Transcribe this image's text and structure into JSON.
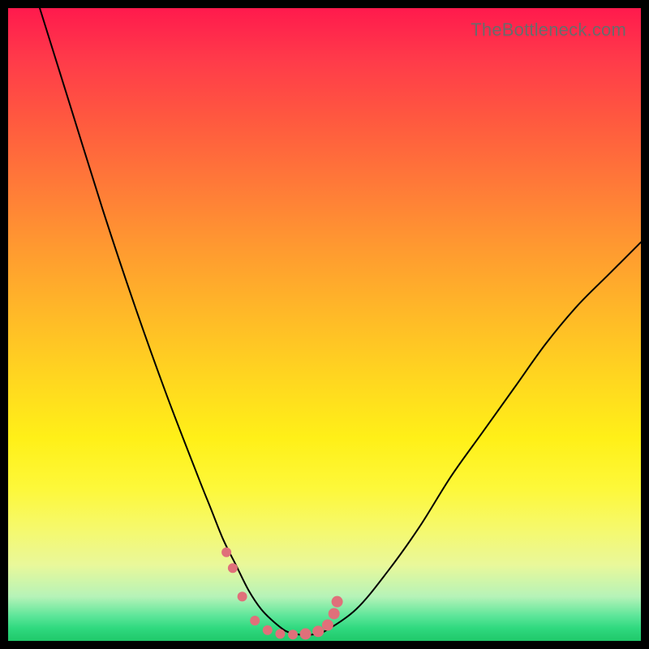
{
  "watermark": {
    "text": "TheBottleneck.com"
  },
  "chart_data": {
    "type": "line",
    "title": "",
    "xlabel": "",
    "ylabel": "",
    "xlim": [
      0,
      100
    ],
    "ylim": [
      0,
      100
    ],
    "grid": false,
    "legend": false,
    "background_gradient": {
      "top": "#ff1a4d",
      "middle": "#fff018",
      "bottom": "#20c86a"
    },
    "series": [
      {
        "name": "bottleneck-curve",
        "color": "#000000",
        "stroke_width": 2,
        "x": [
          5,
          10,
          15,
          20,
          25,
          30,
          32,
          34,
          36,
          38,
          40,
          42,
          44,
          46,
          48,
          50,
          55,
          60,
          65,
          70,
          75,
          80,
          85,
          90,
          95,
          100
        ],
        "y": [
          100,
          84,
          68,
          53,
          39,
          26,
          21,
          16,
          12,
          8,
          5,
          3,
          1.5,
          1,
          1,
          1.5,
          5,
          11,
          18,
          26,
          33,
          40,
          47,
          53,
          58,
          63
        ]
      }
    ],
    "markers": {
      "name": "trough-markers",
      "color": "#e0707a",
      "radius_seq": [
        6,
        6,
        6,
        6,
        6,
        6,
        6,
        7,
        7,
        7,
        7,
        7
      ],
      "x": [
        34.5,
        35.5,
        37.0,
        39.0,
        41.0,
        43.0,
        45.0,
        47.0,
        49.0,
        50.5,
        51.5,
        52.0
      ],
      "y": [
        14.0,
        11.5,
        7.0,
        3.2,
        1.7,
        1.1,
        1.0,
        1.1,
        1.5,
        2.5,
        4.3,
        6.2
      ]
    }
  }
}
